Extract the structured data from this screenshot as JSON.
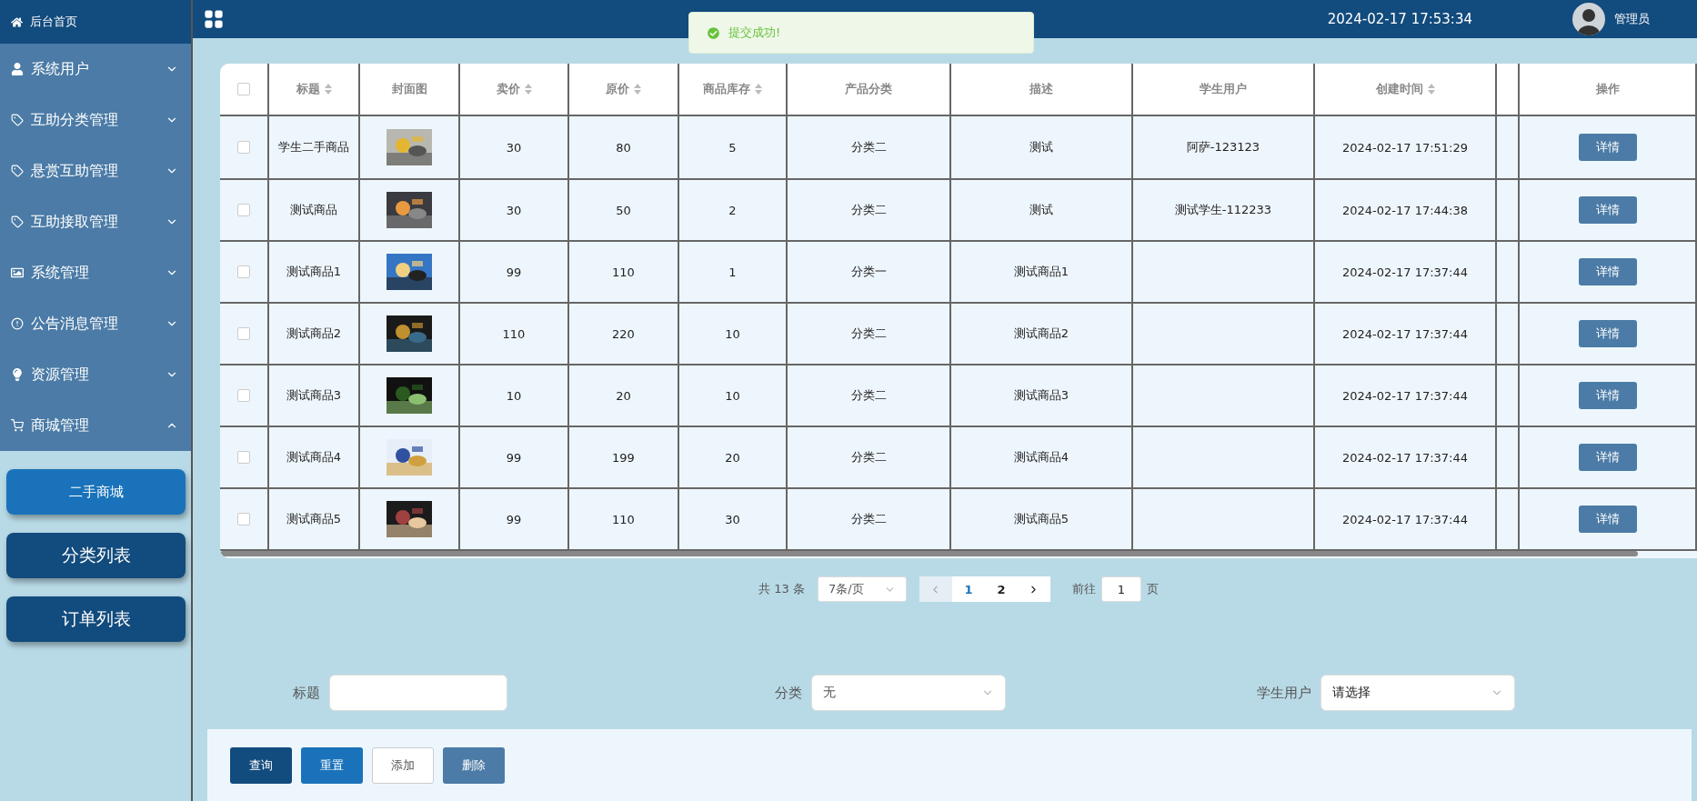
{
  "sidebar": {
    "home": "后台首页",
    "items": [
      {
        "label": "系统用户",
        "expanded": false
      },
      {
        "label": "互助分类管理",
        "expanded": false
      },
      {
        "label": "悬赏互助管理",
        "expanded": false
      },
      {
        "label": "互助接取管理",
        "expanded": false
      },
      {
        "label": "系统管理",
        "expanded": false
      },
      {
        "label": "公告消息管理",
        "expanded": false
      },
      {
        "label": "资源管理",
        "expanded": false
      },
      {
        "label": "商城管理",
        "expanded": true
      }
    ],
    "subitems": [
      {
        "label": "二手商城",
        "selected": true
      },
      {
        "label": "分类列表",
        "selected": false
      },
      {
        "label": "订单列表",
        "selected": false
      }
    ]
  },
  "header": {
    "datetime": "2024-02-17 17:53:34",
    "user": "管理员"
  },
  "toast": {
    "message": "提交成功!"
  },
  "table": {
    "select_all_checked": false,
    "columns": [
      {
        "label": "标题",
        "sortable": true
      },
      {
        "label": "封面图",
        "sortable": false
      },
      {
        "label": "卖价",
        "sortable": true
      },
      {
        "label": "原价",
        "sortable": true
      },
      {
        "label": "商品库存",
        "sortable": true
      },
      {
        "label": "产品分类",
        "sortable": false
      },
      {
        "label": "描述",
        "sortable": false
      },
      {
        "label": "学生用户",
        "sortable": false
      },
      {
        "label": "创建时间",
        "sortable": true
      },
      {
        "label": "操作",
        "sortable": false
      }
    ],
    "rows": [
      {
        "checked": false,
        "title": "学生二手商品",
        "price": "30",
        "original_price": "80",
        "stock": "5",
        "category": "分类二",
        "description": "测试",
        "student": "阿萨-123123",
        "created": "2024-02-17 17:51:29",
        "action": "详情"
      },
      {
        "checked": false,
        "title": "测试商品",
        "price": "30",
        "original_price": "50",
        "stock": "2",
        "category": "分类二",
        "description": "测试",
        "student": "测试学生-112233",
        "created": "2024-02-17 17:44:38",
        "action": "详情"
      },
      {
        "checked": false,
        "title": "测试商品1",
        "price": "99",
        "original_price": "110",
        "stock": "1",
        "category": "分类一",
        "description": "测试商品1",
        "created": "2024-02-17 17:37:44",
        "action": "详情"
      },
      {
        "checked": false,
        "title": "测试商品2",
        "price": "110",
        "original_price": "220",
        "stock": "10",
        "category": "分类二",
        "description": "测试商品2",
        "created": "2024-02-17 17:37:44",
        "action": "详情"
      },
      {
        "checked": false,
        "title": "测试商品3",
        "price": "10",
        "original_price": "20",
        "stock": "10",
        "category": "分类二",
        "description": "测试商品3",
        "created": "2024-02-17 17:37:44",
        "action": "详情"
      },
      {
        "checked": false,
        "title": "测试商品4",
        "price": "99",
        "original_price": "199",
        "stock": "20",
        "category": "分类二",
        "description": "测试商品4",
        "created": "2024-02-17 17:37:44",
        "action": "详情"
      },
      {
        "checked": false,
        "title": "测试商品5",
        "price": "99",
        "original_price": "110",
        "stock": "30",
        "category": "分类二",
        "description": "测试商品5",
        "created": "2024-02-17 17:37:44",
        "action": "详情"
      }
    ]
  },
  "pagination": {
    "total": "共 13 条",
    "page_size": "7条/页",
    "pages": [
      {
        "label": "1",
        "selected": true
      },
      {
        "label": "2",
        "selected": false
      }
    ],
    "goto_label": "前往",
    "goto_value": "1",
    "goto_suffix": "页"
  },
  "filters": [
    {
      "label": "标题",
      "kind": "input"
    },
    {
      "label": "分类",
      "kind": "select",
      "value": "无"
    },
    {
      "label": "学生用户",
      "kind": "select",
      "value": "请选择"
    }
  ],
  "actions": [
    {
      "label": "查询",
      "kind": "dark"
    },
    {
      "label": "重置",
      "kind": "primary"
    },
    {
      "label": "添加",
      "kind": "plain"
    },
    {
      "label": "删除",
      "kind": "muted"
    }
  ]
}
